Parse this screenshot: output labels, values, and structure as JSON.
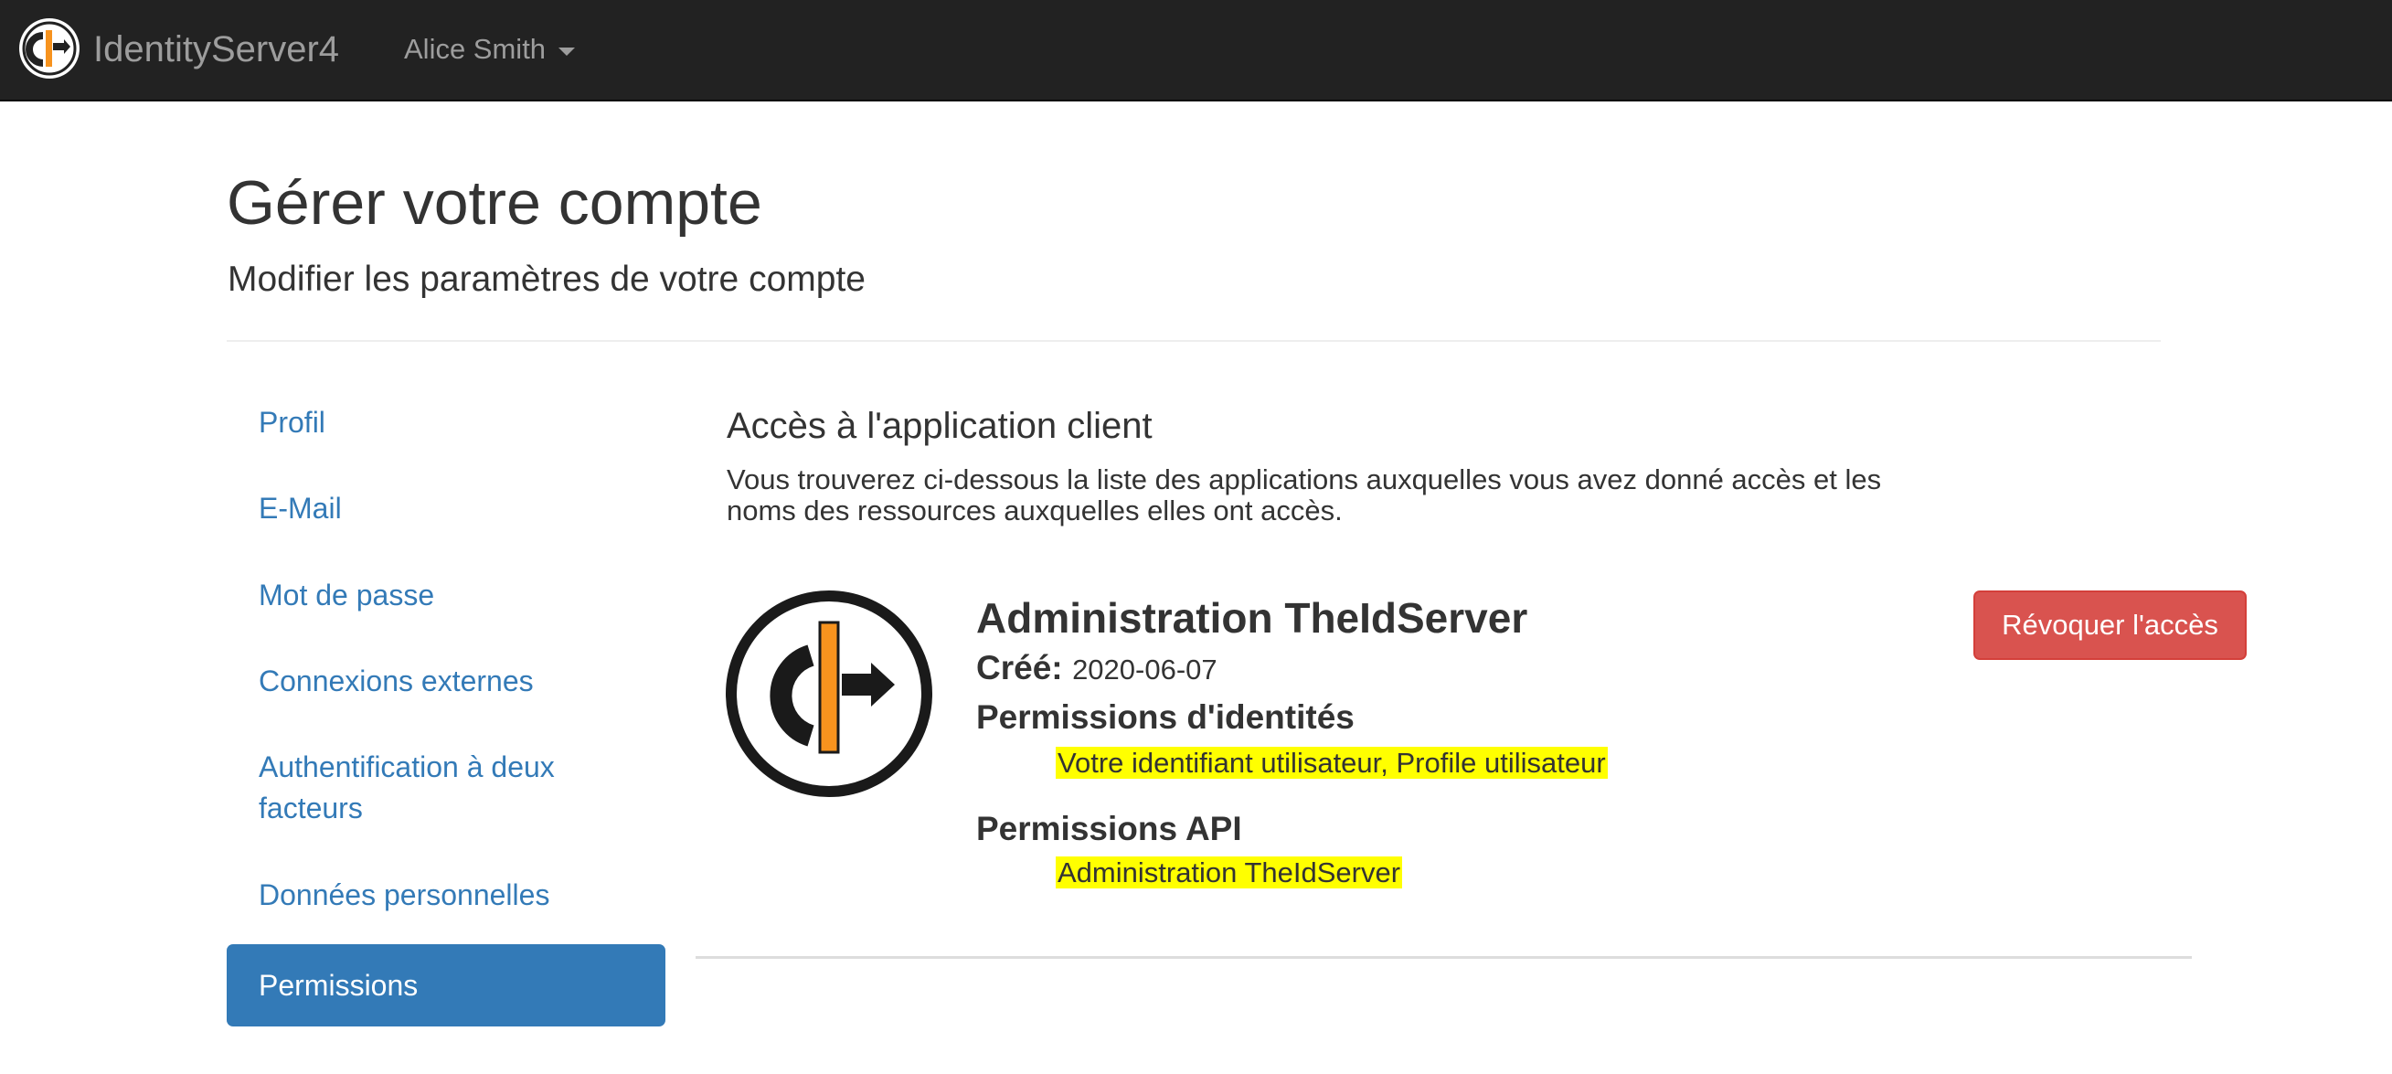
{
  "navbar": {
    "brand": "IdentityServer4",
    "logo_icon": "identityserver-logo-icon",
    "user_name": "Alice Smith",
    "caret_icon": "caret-down-icon"
  },
  "header": {
    "title": "Gérer votre compte",
    "subtitle": "Modifier les paramètres de votre compte"
  },
  "sidebar": {
    "items": [
      {
        "label": "Profil",
        "active": false
      },
      {
        "label": "E-Mail",
        "active": false
      },
      {
        "label": "Mot de passe",
        "active": false
      },
      {
        "label": "Connexions externes",
        "active": false
      },
      {
        "label": "Authentification à deux facteurs",
        "active": false
      },
      {
        "label": "Données personnelles",
        "active": false
      },
      {
        "label": "Permissions",
        "active": true
      }
    ]
  },
  "main": {
    "section_title": "Accès à l'application client",
    "description": "Vous trouverez ci-dessous la liste des applications auxquelles vous avez donné accès et les noms des ressources auxquelles elles ont accès.",
    "clients": [
      {
        "name": "Administration TheIdServer",
        "logo_icon": "theidserver-logo-icon",
        "created_label": "Créé:",
        "created_value": "2020-06-07",
        "identity_heading": "Permissions d'identités",
        "identity_value": "Votre identifiant utilisateur, Profile utilisateur",
        "api_heading": "Permissions API",
        "api_value": "Administration TheIdServer",
        "revoke_label": "Révoquer l'accès"
      }
    ]
  },
  "colors": {
    "navbar_bg": "#222222",
    "link": "#337ab7",
    "active_bg": "#337ab7",
    "danger": "#d9534f",
    "highlight": "#ffff00",
    "logo_orange": "#f7931e"
  }
}
